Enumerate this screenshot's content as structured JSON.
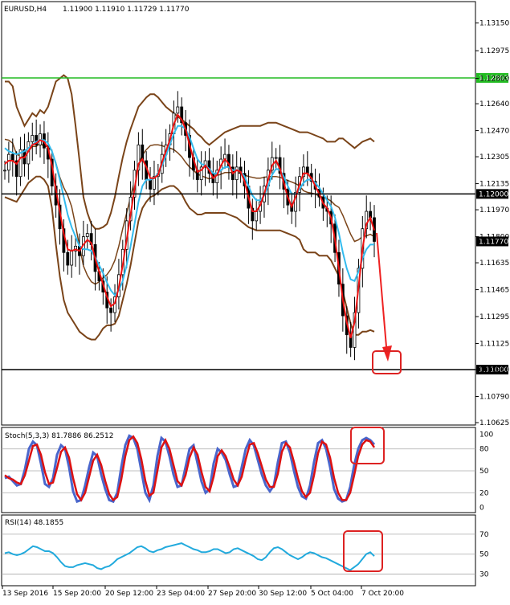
{
  "header": {
    "symbol": "EURUSD,H4",
    "ohlc": "1.11900 1.11910 1.11729 1.11770"
  },
  "chart_data": [
    {
      "type": "candlestick",
      "name": "price",
      "y_ticks": [
        "1.13150",
        "1.12975",
        "1.12800",
        "1.12640",
        "1.12470",
        "1.12305",
        "1.12135",
        "1.11970",
        "1.11800",
        "1.11635",
        "1.11465",
        "1.11295",
        "1.11125",
        "1.10960",
        "1.10790",
        "1.10625"
      ],
      "ylim": [
        1.1062,
        1.1327
      ],
      "highlight_levels": [
        {
          "label": "1.12803",
          "value": 1.12803,
          "color": "#22bb22"
        },
        {
          "label": "1.12000",
          "value": 1.1207,
          "color": "#000000"
        },
        {
          "label": "1.11000",
          "value": 1.1096,
          "color": "#000000"
        }
      ],
      "current_price": {
        "label": "1.11770",
        "value": 1.1177
      },
      "series_close": [
        1.1222,
        1.1232,
        1.1228,
        1.1218,
        1.1235,
        1.1226,
        1.124,
        1.1244,
        1.1238,
        1.1245,
        1.1236,
        1.1229,
        1.1212,
        1.12,
        1.1185,
        1.117,
        1.1162,
        1.1171,
        1.1174,
        1.1168,
        1.118,
        1.1182,
        1.1175,
        1.1158,
        1.1152,
        1.1145,
        1.1135,
        1.1132,
        1.1142,
        1.1156,
        1.1172,
        1.119,
        1.1205,
        1.1222,
        1.1238,
        1.1228,
        1.1216,
        1.121,
        1.1218,
        1.122,
        1.1232,
        1.1238,
        1.1245,
        1.1258,
        1.1262,
        1.1252,
        1.1244,
        1.123,
        1.1222,
        1.1216,
        1.1224,
        1.1228,
        1.122,
        1.1214,
        1.1222,
        1.1229,
        1.1232,
        1.1224,
        1.1216,
        1.1224,
        1.122,
        1.1212,
        1.1198,
        1.119,
        1.1196,
        1.1202,
        1.1212,
        1.1222,
        1.123,
        1.123,
        1.122,
        1.121,
        1.12,
        1.1196,
        1.1208,
        1.1218,
        1.1224,
        1.122,
        1.1215,
        1.121,
        1.1205,
        1.1198,
        1.1196,
        1.1188,
        1.117,
        1.115,
        1.113,
        1.1118,
        1.111,
        1.1132,
        1.116,
        1.1185,
        1.1196,
        1.1192,
        1.1177
      ],
      "series_ma_red": [
        1.1226,
        1.1228,
        1.1228,
        1.1226,
        1.123,
        1.123,
        1.1234,
        1.1238,
        1.1239,
        1.1241,
        1.124,
        1.1236,
        1.1225,
        1.121,
        1.1196,
        1.1182,
        1.1172,
        1.1171,
        1.1172,
        1.1171,
        1.1175,
        1.1178,
        1.1176,
        1.1166,
        1.1158,
        1.115,
        1.1142,
        1.1136,
        1.1138,
        1.1148,
        1.1162,
        1.1178,
        1.1194,
        1.121,
        1.1226,
        1.1229,
        1.1224,
        1.1217,
        1.1217,
        1.1219,
        1.1227,
        1.1234,
        1.1241,
        1.1251,
        1.1257,
        1.1254,
        1.1248,
        1.1238,
        1.1229,
        1.1221,
        1.1222,
        1.1225,
        1.1222,
        1.1217,
        1.1219,
        1.1225,
        1.1229,
        1.1226,
        1.122,
        1.1222,
        1.1221,
        1.1215,
        1.1205,
        1.1196,
        1.1196,
        1.12,
        1.1207,
        1.1216,
        1.1225,
        1.1228,
        1.1223,
        1.1214,
        1.1205,
        1.1199,
        1.1205,
        1.1213,
        1.122,
        1.122,
        1.1217,
        1.1212,
        1.1207,
        1.1201,
        1.1198,
        1.1192,
        1.1178,
        1.116,
        1.114,
        1.1126,
        1.1116,
        1.1126,
        1.1148,
        1.1172,
        1.1188,
        1.1192,
        1.1184
      ],
      "series_ma_cyan": [
        1.1236,
        1.1234,
        1.1233,
        1.1232,
        1.1233,
        1.1234,
        1.1236,
        1.1238,
        1.124,
        1.1241,
        1.1241,
        1.1239,
        1.1234,
        1.1226,
        1.1216,
        1.1205,
        1.1194,
        1.1186,
        1.118,
        1.1174,
        1.1172,
        1.1172,
        1.1171,
        1.1167,
        1.1162,
        1.1157,
        1.1151,
        1.1146,
        1.1143,
        1.1146,
        1.1152,
        1.1162,
        1.1174,
        1.1188,
        1.1202,
        1.1212,
        1.1216,
        1.1216,
        1.1217,
        1.122,
        1.1225,
        1.1231,
        1.1238,
        1.1245,
        1.125,
        1.125,
        1.1248,
        1.1243,
        1.1236,
        1.1229,
        1.1226,
        1.1225,
        1.1223,
        1.122,
        1.122,
        1.1222,
        1.1224,
        1.1224,
        1.1222,
        1.1222,
        1.1221,
        1.1218,
        1.1212,
        1.1206,
        1.1203,
        1.1203,
        1.1206,
        1.1212,
        1.1219,
        1.1223,
        1.1222,
        1.1218,
        1.1212,
        1.1207,
        1.1207,
        1.121,
        1.1214,
        1.1216,
        1.1216,
        1.1214,
        1.1211,
        1.1207,
        1.1203,
        1.1199,
        1.1192,
        1.1182,
        1.117,
        1.116,
        1.1153,
        1.1152,
        1.1158,
        1.1166,
        1.1172,
        1.1175,
        1.1175
      ],
      "series_bb_upper": [
        1.1278,
        1.1278,
        1.1275,
        1.1262,
        1.1256,
        1.125,
        1.1254,
        1.1258,
        1.1256,
        1.126,
        1.1258,
        1.1262,
        1.127,
        1.1278,
        1.128,
        1.1282,
        1.128,
        1.127,
        1.125,
        1.1228,
        1.1205,
        1.1195,
        1.1188,
        1.1185,
        1.1185,
        1.1186,
        1.1188,
        1.1195,
        1.1205,
        1.1218,
        1.123,
        1.124,
        1.1248,
        1.1255,
        1.1262,
        1.1265,
        1.1268,
        1.127,
        1.127,
        1.1268,
        1.1265,
        1.1262,
        1.126,
        1.1258,
        1.1256,
        1.1254,
        1.1252,
        1.125,
        1.1248,
        1.1245,
        1.1243,
        1.124,
        1.1238,
        1.124,
        1.1242,
        1.1244,
        1.1246,
        1.1247,
        1.1248,
        1.1249,
        1.125,
        1.125,
        1.125,
        1.125,
        1.125,
        1.125,
        1.1251,
        1.1252,
        1.1252,
        1.1252,
        1.1251,
        1.125,
        1.1249,
        1.1248,
        1.1247,
        1.1246,
        1.1246,
        1.1246,
        1.1245,
        1.1244,
        1.1243,
        1.1242,
        1.124,
        1.124,
        1.124,
        1.1242,
        1.1242,
        1.124,
        1.1238,
        1.1236,
        1.1238,
        1.124,
        1.1241,
        1.1242,
        1.124
      ],
      "series_bb_lower": [
        1.1205,
        1.1204,
        1.1203,
        1.1202,
        1.1206,
        1.121,
        1.1214,
        1.1216,
        1.1218,
        1.1218,
        1.1216,
        1.1212,
        1.1198,
        1.1175,
        1.1155,
        1.114,
        1.1132,
        1.1128,
        1.1124,
        1.112,
        1.1118,
        1.1116,
        1.1115,
        1.1115,
        1.1118,
        1.1122,
        1.1124,
        1.1124,
        1.1125,
        1.113,
        1.114,
        1.115,
        1.1162,
        1.1176,
        1.119,
        1.1198,
        1.1202,
        1.1205,
        1.1206,
        1.1208,
        1.121,
        1.1211,
        1.1212,
        1.1212,
        1.121,
        1.1207,
        1.1202,
        1.1198,
        1.1196,
        1.1194,
        1.1194,
        1.1195,
        1.1195,
        1.1195,
        1.1195,
        1.1195,
        1.1195,
        1.1194,
        1.1193,
        1.1192,
        1.119,
        1.1188,
        1.1186,
        1.1185,
        1.1184,
        1.1184,
        1.1184,
        1.1184,
        1.1184,
        1.1184,
        1.1184,
        1.1183,
        1.1182,
        1.1181,
        1.118,
        1.1178,
        1.1172,
        1.117,
        1.117,
        1.117,
        1.1168,
        1.1168,
        1.1168,
        1.1165,
        1.116,
        1.1155,
        1.1145,
        1.1135,
        1.1125,
        1.1118,
        1.1118,
        1.112,
        1.112,
        1.1121,
        1.112
      ]
    },
    {
      "type": "line",
      "name": "stochastic",
      "label": "Stoch(5,3,3) 81.7886 86.2512",
      "y_ticks": [
        "100",
        "80",
        "50",
        "20",
        "0"
      ],
      "ylim": [
        -5,
        105
      ],
      "series_main": [
        40,
        42,
        36,
        30,
        32,
        52,
        80,
        90,
        85,
        60,
        32,
        28,
        40,
        72,
        85,
        80,
        55,
        22,
        8,
        10,
        30,
        55,
        75,
        70,
        45,
        25,
        10,
        8,
        20,
        55,
        85,
        98,
        95,
        80,
        50,
        20,
        10,
        30,
        70,
        95,
        90,
        70,
        45,
        28,
        30,
        55,
        80,
        85,
        60,
        35,
        20,
        25,
        60,
        80,
        75,
        65,
        45,
        28,
        30,
        55,
        80,
        92,
        85,
        65,
        45,
        30,
        22,
        30,
        62,
        88,
        90,
        75,
        50,
        28,
        15,
        12,
        30,
        62,
        88,
        92,
        80,
        55,
        25,
        12,
        8,
        10,
        28,
        58,
        80,
        92,
        95,
        92,
        86
      ],
      "series_signal": [
        44,
        40,
        38,
        34,
        32,
        44,
        64,
        84,
        86,
        72,
        48,
        32,
        34,
        54,
        76,
        82,
        68,
        40,
        18,
        10,
        20,
        42,
        64,
        72,
        58,
        36,
        18,
        10,
        14,
        38,
        70,
        92,
        97,
        88,
        66,
        36,
        16,
        20,
        50,
        82,
        92,
        80,
        58,
        36,
        30,
        44,
        68,
        82,
        72,
        48,
        28,
        22,
        42,
        70,
        78,
        70,
        55,
        38,
        30,
        42,
        66,
        86,
        88,
        74,
        56,
        38,
        28,
        28,
        46,
        76,
        88,
        82,
        62,
        40,
        22,
        14,
        20,
        44,
        74,
        90,
        86,
        68,
        40,
        20,
        10,
        10,
        20,
        44,
        70,
        86,
        92,
        90,
        82
      ]
    },
    {
      "type": "line",
      "name": "rsi",
      "label": "RSI(14) 48.1855",
      "y_ticks": [
        "70",
        "50",
        "30"
      ],
      "ylim": [
        20,
        82
      ],
      "series_rsi": [
        51,
        52,
        50,
        49,
        50,
        52,
        55,
        58,
        57,
        55,
        53,
        53,
        51,
        47,
        42,
        38,
        37,
        37,
        39,
        40,
        41,
        40,
        39,
        36,
        35,
        37,
        38,
        41,
        45,
        47,
        49,
        51,
        54,
        57,
        58,
        56,
        53,
        52,
        54,
        55,
        57,
        58,
        59,
        60,
        61,
        59,
        57,
        55,
        54,
        52,
        52,
        53,
        55,
        55,
        53,
        51,
        52,
        55,
        56,
        54,
        52,
        50,
        48,
        45,
        44,
        47,
        52,
        56,
        57,
        55,
        52,
        49,
        47,
        45,
        47,
        50,
        52,
        51,
        49,
        47,
        46,
        44,
        42,
        40,
        38,
        36,
        34,
        37,
        40,
        45,
        50,
        52,
        48
      ]
    }
  ],
  "x_axis": {
    "labels": [
      "13 Sep 2016",
      "15 Sep 20:00",
      "20 Sep 12:00",
      "23 Sep 04:00",
      "27 Sep 20:00",
      "30 Sep 12:00",
      "5 Oct 04:00",
      "7 Oct 20:00"
    ]
  },
  "annotation_colors": {
    "arrow": "#ee2222",
    "box": "#dd2222"
  }
}
